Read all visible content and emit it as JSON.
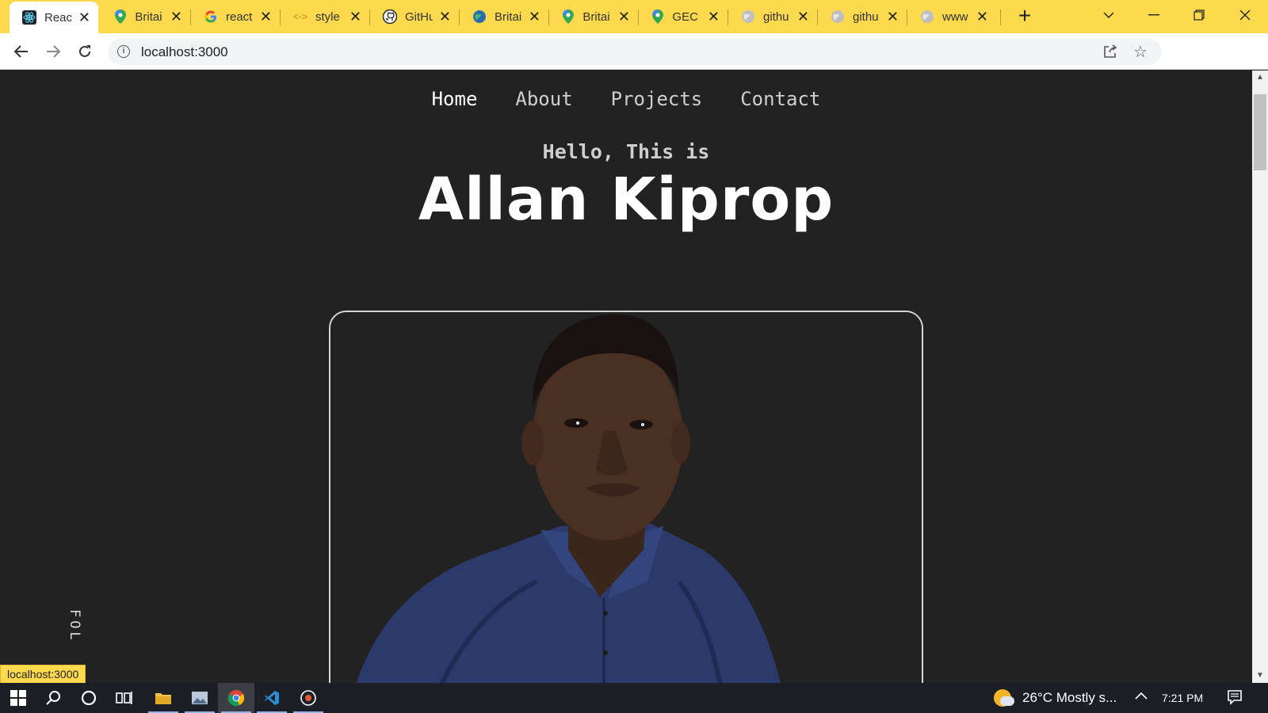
{
  "browser": {
    "tabs": [
      {
        "title": "React",
        "icon": "react-icon",
        "active": true
      },
      {
        "title": "Britai",
        "icon": "maps-pin-icon"
      },
      {
        "title": "react",
        "icon": "google-icon"
      },
      {
        "title": "style",
        "icon": "code-icon"
      },
      {
        "title": "GitHu",
        "icon": "github-icon"
      },
      {
        "title": "Britai",
        "icon": "globe-icon"
      },
      {
        "title": "Britai",
        "icon": "maps-pin-icon"
      },
      {
        "title": "GEC",
        "icon": "maps-pin-icon"
      },
      {
        "title": "githu",
        "icon": "globe-icon"
      },
      {
        "title": "githu",
        "icon": "globe-icon"
      },
      {
        "title": "www",
        "icon": "globe-icon"
      }
    ],
    "url": "localhost:3000",
    "status_url": "localhost:3000"
  },
  "page": {
    "nav": [
      {
        "label": "Home",
        "active": true
      },
      {
        "label": "About"
      },
      {
        "label": "Projects"
      },
      {
        "label": "Contact"
      }
    ],
    "greeting": "Hello, This is",
    "name": "Allan Kiprop",
    "follow_text": "FOL"
  },
  "taskbar": {
    "weather": "26°C  Mostly s...",
    "time": "7:21 PM"
  },
  "colors": {
    "tab_strip": "#fcd94d",
    "page_bg": "#222222",
    "shirt": "#2b3a6b"
  }
}
